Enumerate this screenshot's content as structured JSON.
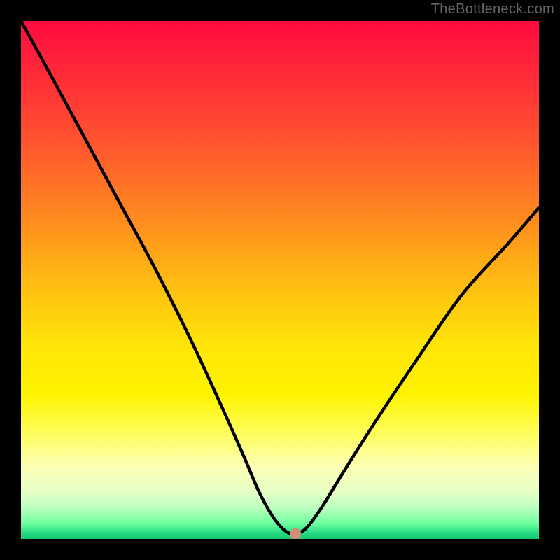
{
  "watermark": "TheBottleneck.com",
  "chart_data": {
    "type": "line",
    "title": "",
    "xlabel": "",
    "ylabel": "",
    "xlim": [
      0,
      100
    ],
    "ylim": [
      0,
      100
    ],
    "background_gradient": {
      "top": "#ff0b3f",
      "middle": "#ffe308",
      "bottom": "#17c76f"
    },
    "series": [
      {
        "name": "bottleneck-curve",
        "stroke": "#000000",
        "x": [
          0,
          5.5,
          12,
          19,
          26,
          33,
          39,
          43,
          46,
          48.5,
          50.5,
          52,
          53,
          55,
          58,
          62,
          68,
          76,
          85,
          94,
          100
        ],
        "y": [
          100,
          90,
          78,
          65,
          52,
          38,
          25,
          16,
          9,
          4.5,
          2,
          1,
          1,
          2,
          6,
          12.5,
          22,
          34,
          47,
          57,
          64
        ]
      }
    ],
    "marker": {
      "x": 53,
      "y": 1,
      "color": "#d48d7a"
    }
  }
}
